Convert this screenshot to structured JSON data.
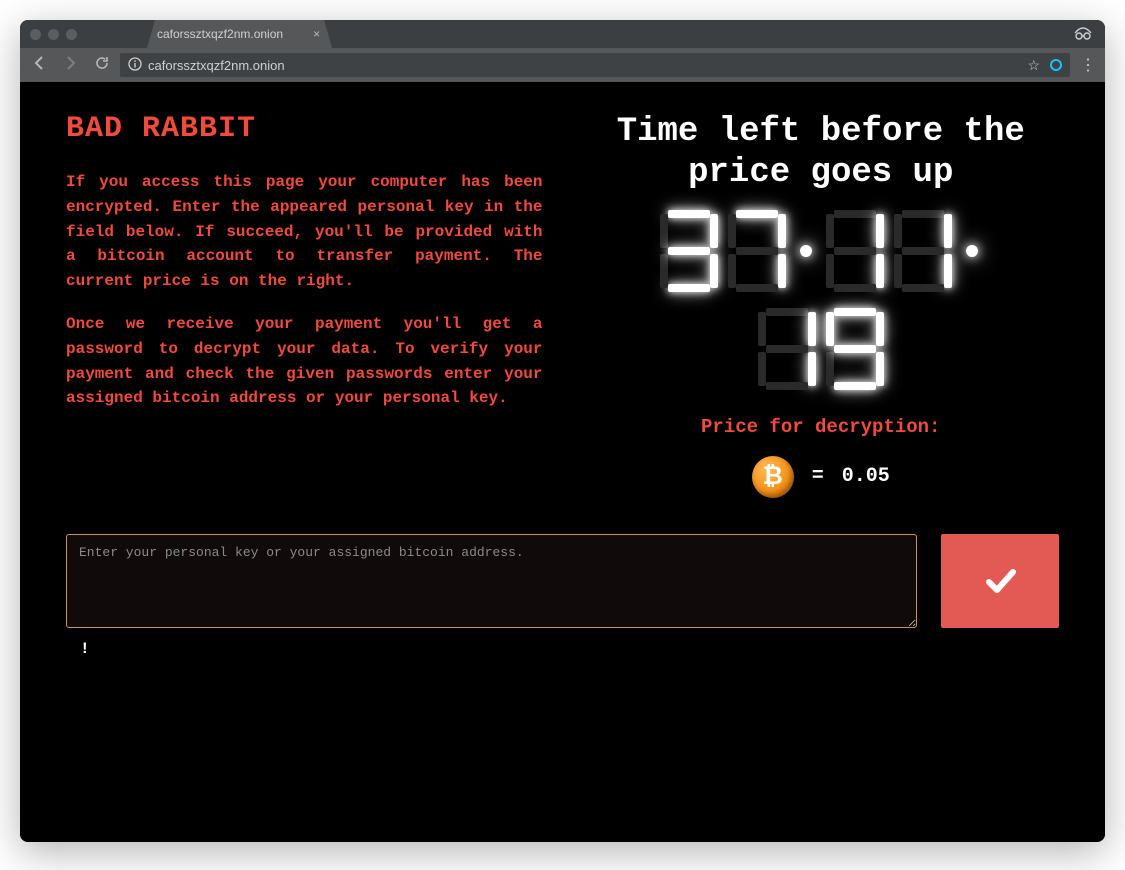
{
  "browser": {
    "tab_title": "caforssztxqzf2nm.onion",
    "url": "caforssztxqzf2nm.onion"
  },
  "page": {
    "title": "BAD RABBIT",
    "paragraph1": "If you access this page your computer has been encrypted. Enter the appeared personal key in the field below. If succeed, you'll be provided with a bitcoin account to transfer payment. The current price is on the right.",
    "paragraph2": "Once we receive your payment you'll get a password to decrypt your data. To verify your payment and check the given passwords enter your assigned bitcoin address or your personal key."
  },
  "countdown": {
    "heading": "Time left before the price goes up",
    "hours": "37",
    "minutes": "11",
    "seconds": "19"
  },
  "price": {
    "label": "Price for decryption:",
    "equals": "=",
    "amount": "0.05"
  },
  "form": {
    "placeholder": "Enter your personal key or your assigned bitcoin address.",
    "status": "!"
  }
}
